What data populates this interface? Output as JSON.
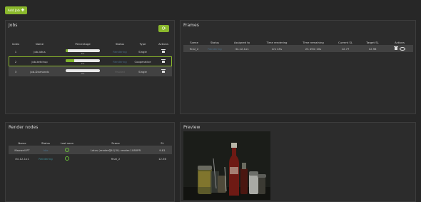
{
  "toolbar": {
    "add_job_label": "Add Job",
    "add_job_icon": "plus-icon"
  },
  "jobs": {
    "title": "Jobs",
    "refresh_icon": "refresh-icon",
    "columns": [
      "Index",
      "Name",
      "Percentage",
      "Status",
      "Type",
      "Actions"
    ],
    "rows": [
      {
        "index": "1",
        "name": "job-lotus",
        "progress": 0.06,
        "percent_label": "6%",
        "status": "Rendering",
        "type": "Single"
      },
      {
        "index": "2",
        "name": "job-ketchup",
        "progress": 0.24,
        "percent_label": "2%",
        "status": "Rendering",
        "type": "Cooperative"
      },
      {
        "index": "3",
        "name": "job-Diamonds",
        "progress": 0.0,
        "percent_label": "0%",
        "status": "Paused",
        "type": "Single"
      }
    ]
  },
  "frames": {
    "title": "Frames",
    "columns": [
      "Scene",
      "Status",
      "Assigned to",
      "Time rendering",
      "Time remaining",
      "Current SL",
      "Target SL",
      "Actions"
    ],
    "rows": [
      {
        "scene": "final_2",
        "status": "Rendering",
        "assigned_to": "rkl-12-1x1",
        "time_rendering": "4m 45s",
        "time_remaining": "2h 49m 20s",
        "current_sl": "12.77",
        "target_sl": "12.96"
      }
    ]
  },
  "render_nodes": {
    "title": "Render nodes",
    "columns": [
      "Name",
      "Status",
      "Last seen",
      "Scene",
      "SL"
    ],
    "rows": [
      {
        "name": "Maxwell PT",
        "status": "Idle",
        "last_seen_icon": "check-icon",
        "scene": "Lotus (render@t1)30; render-1080PR",
        "sl": "9.81"
      },
      {
        "name": "rkl-12-1x1",
        "status": "Rendering",
        "last_seen_icon": "check-icon",
        "scene": "final_2",
        "sl": "12.56"
      }
    ]
  },
  "preview": {
    "title": "Preview"
  },
  "colors": {
    "accent": "#8ab82c",
    "background": "#272727",
    "panel": "#2c2c2c",
    "status_text": "#4a6d88"
  }
}
